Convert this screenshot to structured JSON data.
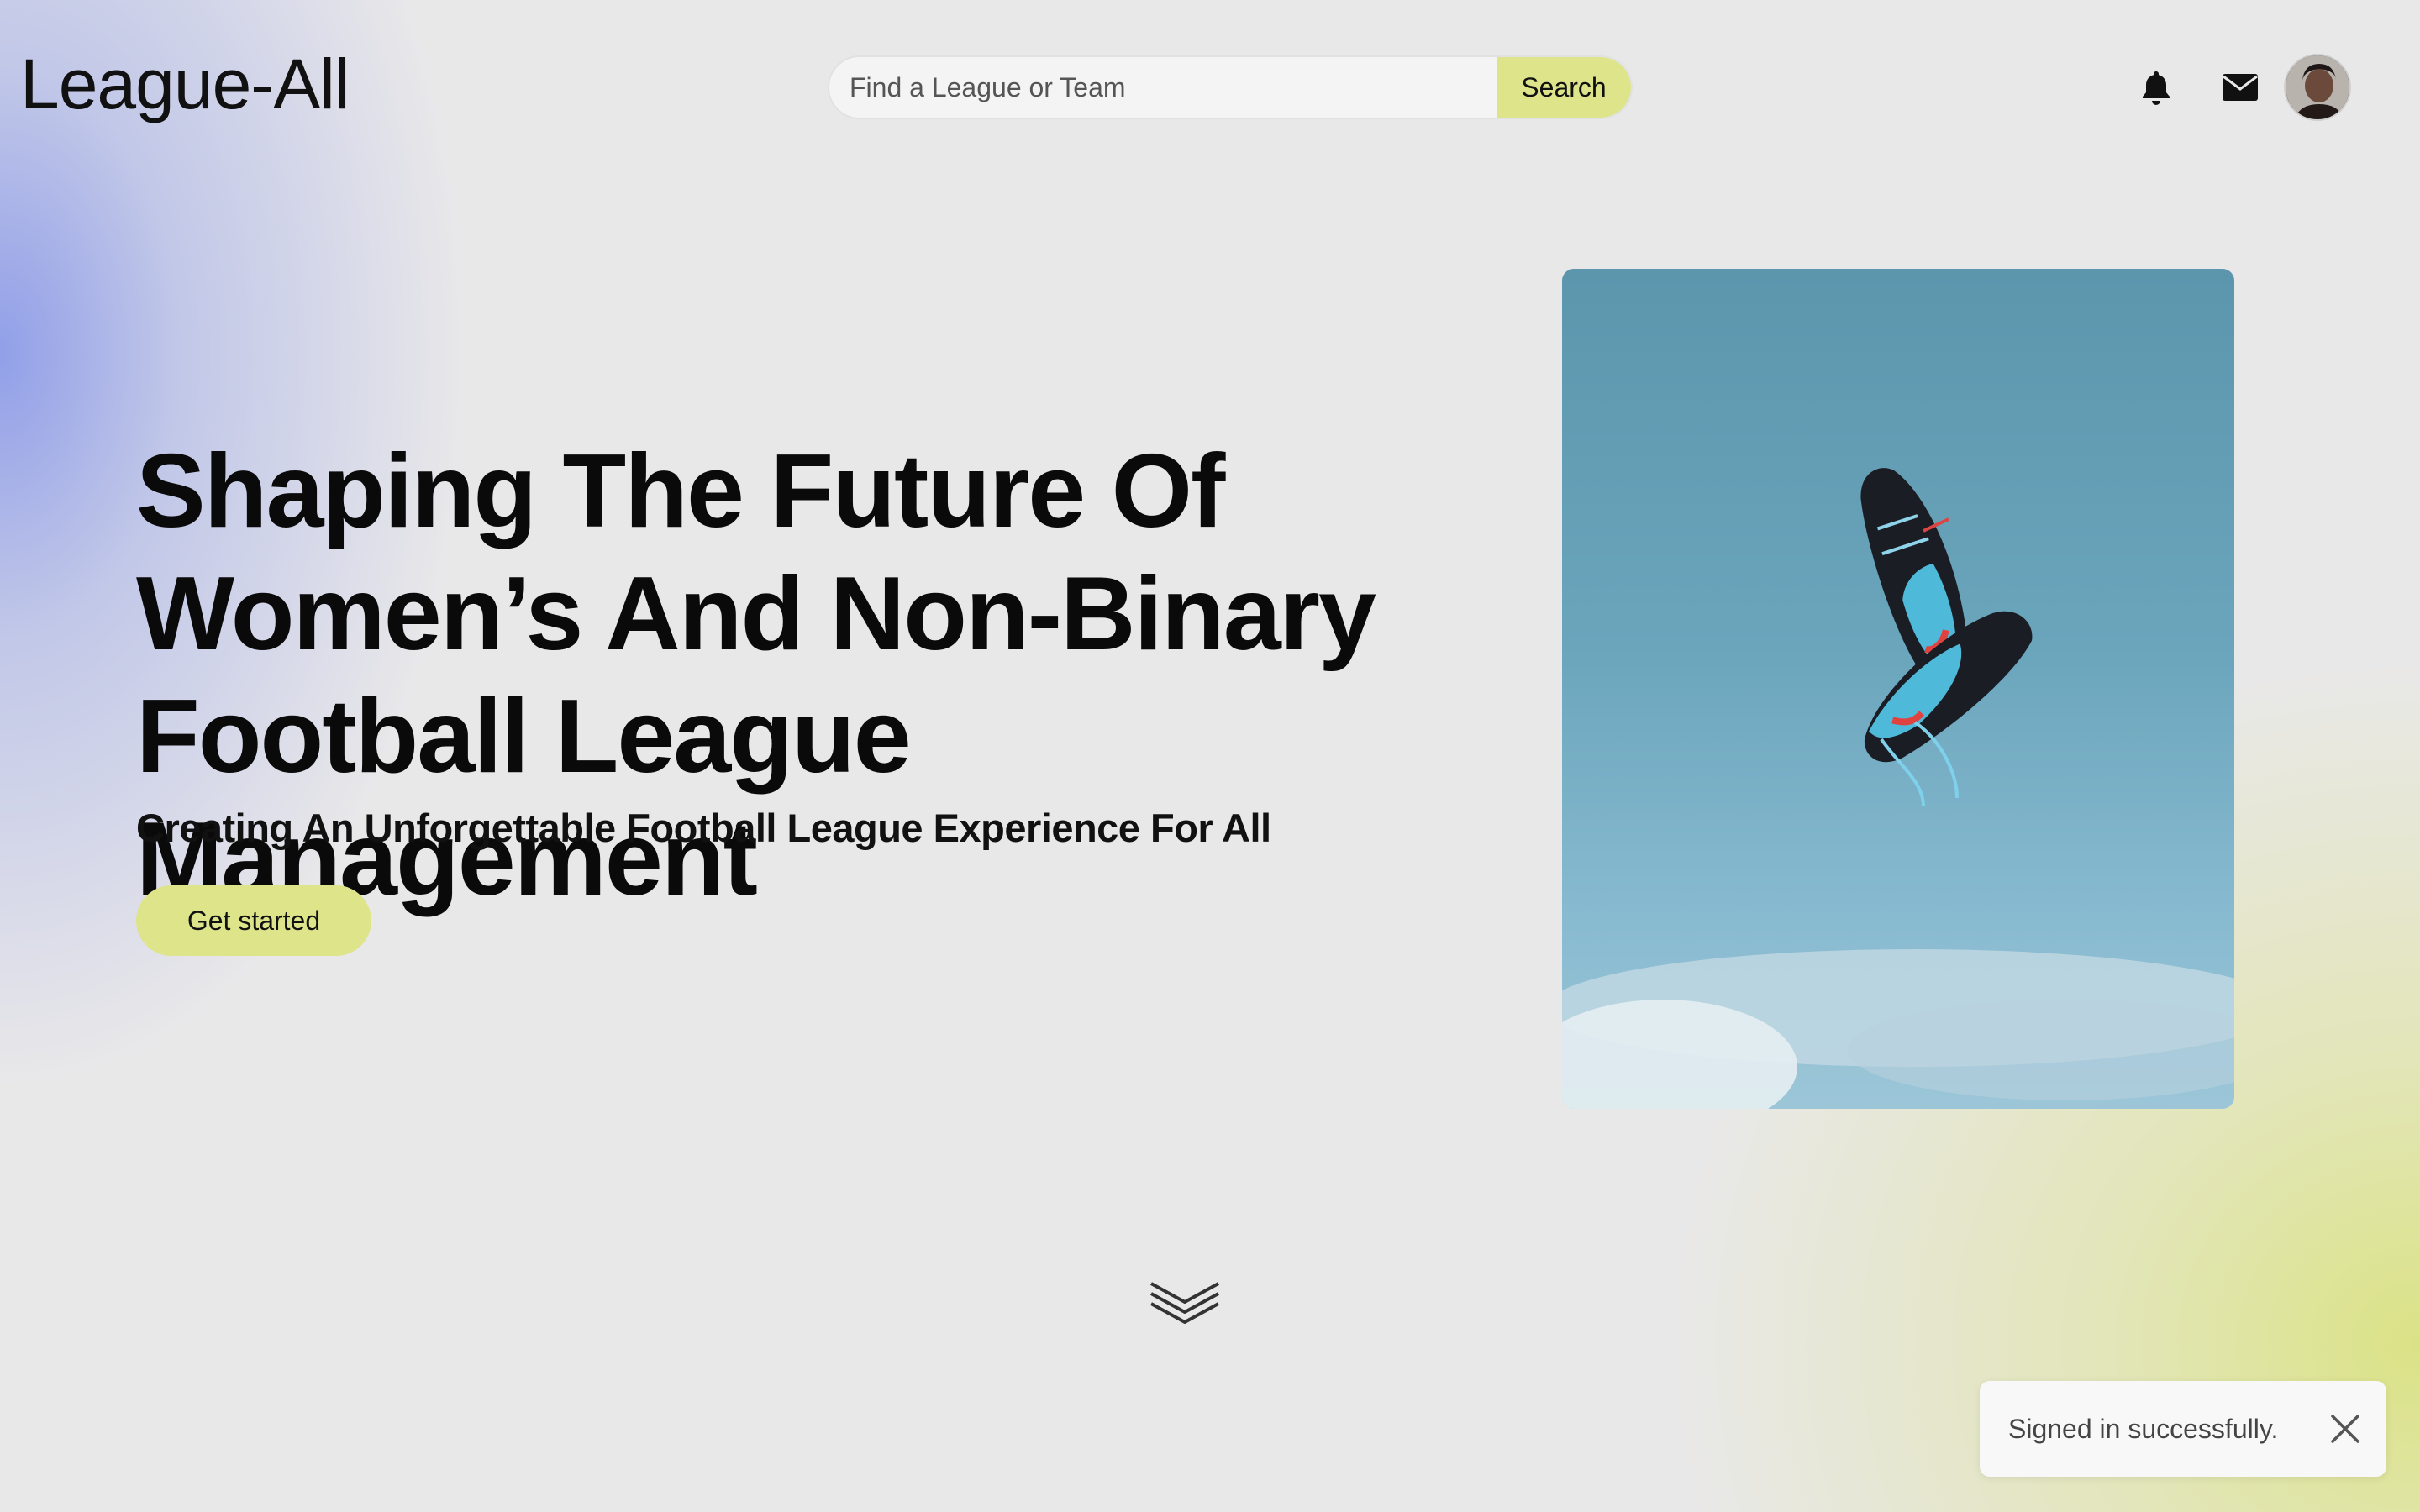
{
  "header": {
    "logo": "League-All",
    "search": {
      "placeholder": "Find a League or Team",
      "value": "",
      "button_label": "Search"
    },
    "icons": [
      "bell-icon",
      "mail-icon"
    ],
    "avatar": "user-avatar"
  },
  "hero": {
    "title_lines": [
      "Shaping The Future Of",
      "Women’s And Non-Binary",
      "Football League Management"
    ],
    "subtitle": "Creating An Unforgettable Football League Experience For All",
    "cta_label": "Get started"
  },
  "scroll_icon": "double-chevron-down-icon",
  "toast": {
    "message": "Signed in successfully.",
    "close_icon": "close-icon"
  },
  "colors": {
    "accent": "#dde48a",
    "text": "#0b0b0b",
    "background": "#e9e8e9",
    "gradient_blue": "#8c9be8",
    "gradient_lime": "#dae280"
  }
}
